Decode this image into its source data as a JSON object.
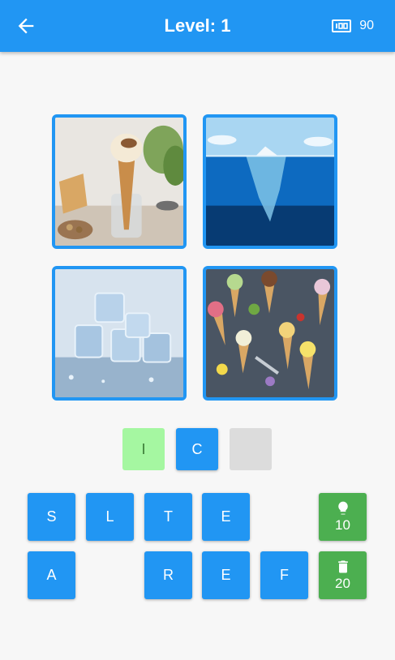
{
  "header": {
    "title": "Level: 1",
    "coins": "90",
    "back_icon": "arrow-left-icon",
    "coin_icon": "coin-counter-icon"
  },
  "puzzle": {
    "images": [
      "ice cream cone in glass",
      "iceberg under water",
      "ice cubes",
      "ice cream cones on table"
    ]
  },
  "answer": {
    "slots": [
      {
        "letter": "I",
        "state": "correct"
      },
      {
        "letter": "C",
        "state": "filled"
      },
      {
        "letter": "",
        "state": "empty"
      }
    ]
  },
  "keyboard": {
    "row1": [
      "S",
      "L",
      "T",
      "E"
    ],
    "row2": [
      "A",
      "R",
      "E",
      "F"
    ]
  },
  "helpers": {
    "hint": {
      "icon": "lightbulb-icon",
      "cost": "10"
    },
    "remove": {
      "icon": "trash-icon",
      "cost": "20"
    }
  },
  "colors": {
    "primary": "#2196f3",
    "success": "#4caf50",
    "correct_slot": "#a5f7a1",
    "empty_slot": "#dcdcdc"
  }
}
